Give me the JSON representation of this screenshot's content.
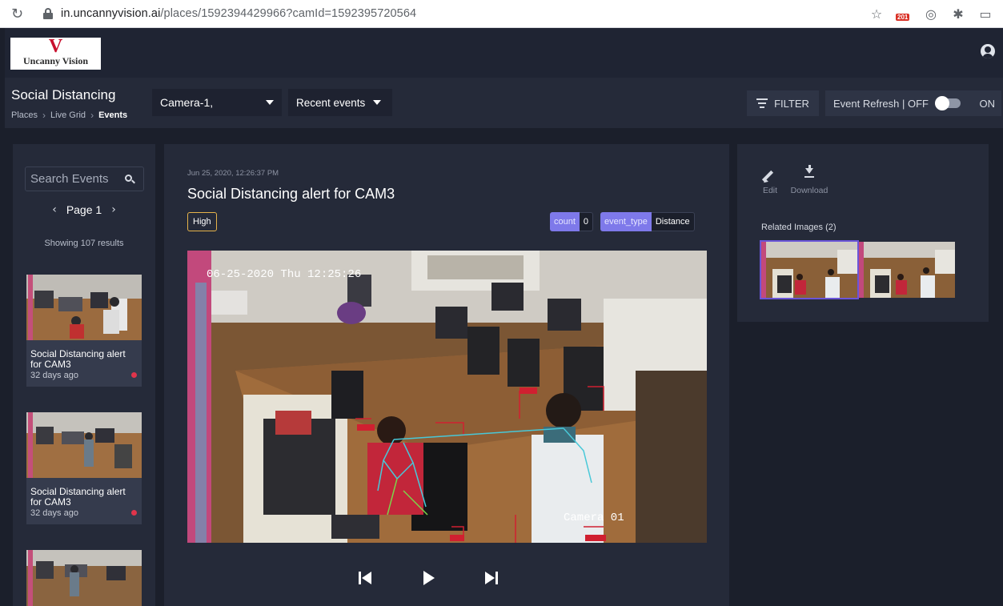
{
  "browser": {
    "reload_icon": "reload-icon",
    "url_host": "in.uncannyvision.ai",
    "url_path": "/places/1592394429966?camId=1592395720564",
    "bookmark_icon": "star-icon",
    "extension_badge": "201"
  },
  "app": {
    "logo_letter": "V",
    "logo_text": "Uncanny Vision",
    "user_icon": "user-circle-icon"
  },
  "subheader": {
    "title": "Social Distancing",
    "breadcrumb": [
      "Places",
      "Live Grid",
      "Events"
    ],
    "camera_select": "Camera-1,",
    "events_select": "Recent events",
    "filter_label": "FILTER",
    "refresh_label": "Event Refresh | OFF",
    "refresh_on_label": "ON",
    "refresh_state": "off"
  },
  "sidebar": {
    "search_placeholder": "Search Events",
    "page_label": "Page 1",
    "showing": "Showing 107 results",
    "events": [
      {
        "title": "Social Distancing alert for CAM3",
        "time": "32 days ago",
        "status_color": "#e0344b"
      },
      {
        "title": "Social Distancing alert for CAM3",
        "time": "32 days ago",
        "status_color": "#e0344b"
      },
      {
        "title": "",
        "time": "",
        "status_color": ""
      }
    ]
  },
  "event": {
    "date": "Jun 25, 2020, 12:26:37 PM",
    "title": "Social Distancing alert for CAM3",
    "severity": "High",
    "tags": [
      {
        "key": "count",
        "value": "0"
      },
      {
        "key": "event_type",
        "value": "Distance"
      }
    ],
    "image_overlay": {
      "timestamp": "06-25-2020 Thu 12:25:26",
      "camera_label": "Camera 01"
    },
    "controls": [
      "previous-icon",
      "play-icon",
      "next-icon"
    ]
  },
  "details": {
    "edit_label": "Edit",
    "download_label": "Download",
    "related_title": "Related Images",
    "related_count": "(2)"
  },
  "colors": {
    "accent": "#7e79ea",
    "severity_high": "#e6b34a",
    "alert_dot": "#e0344b",
    "selected_outline": "#6a55d8"
  }
}
